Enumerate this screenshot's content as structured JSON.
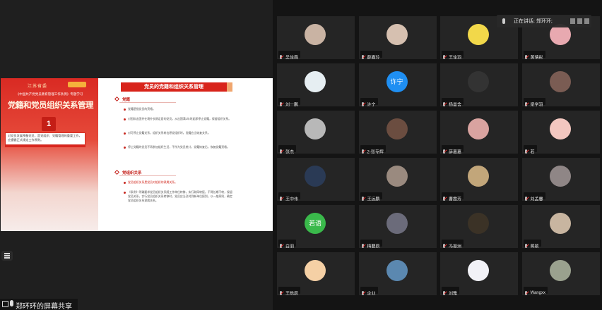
{
  "slide": {
    "logo": "江苏省委",
    "doc_title": "《中国共产党党员教育管理工作条例》专题学习",
    "main_title": "党籍和党员组织关系管理",
    "number": "1",
    "box_text": "对党员发展预备党员，是党组织、党籍管理的重要工作，应遵循正式规定工作原则。",
    "heading": "党员的党籍和组织关系管理",
    "section1": "党籍",
    "bullets1": [
      "党籍是指党员的资格。",
      "对因私出国并在境外长期定居的党员，从出国满2年时起即停止党籍，保留组织关系。",
      "对可停止党籍关系，组织关系转出原党组织时，党籍应当恢复关系。",
      "停止党籍的党员不再参加组织生活，不作为党员统计，党籍恢复后，恢复党籍资格。"
    ],
    "section2": "党组织关系",
    "bullets2": [
      "党员组织关系是党员对组织的隶属关系。",
      "《条例》明确要求党员组织关系随工作单位转移，实行联网转接，不得长期不转，保留党员关系，实行党员组织关系转移时，党员应当及时到新单位报到。以一般原则，确定党员组织关系隶属关系。"
    ]
  },
  "footer": {
    "text": "郑环环的屏幕共享"
  },
  "speaking": {
    "text": "正在讲话: 郑环环;"
  },
  "participants": [
    {
      "name": "吴佳霖",
      "avatar": "photo",
      "color": "#c9b3a3"
    },
    {
      "name": "薛嘉玲",
      "avatar": "photo",
      "color": "#d6c0b0"
    },
    {
      "name": "王佳羽",
      "avatar": "sponge",
      "color": "#f2d84a"
    },
    {
      "name": "黄晴彤",
      "avatar": "cartoon",
      "color": "#e8a9b0"
    },
    {
      "name": "刘一鹏",
      "avatar": "cartoon",
      "color": "#e6eef2"
    },
    {
      "name": "许宁",
      "avatar": "text",
      "text": "许宁",
      "color": "#1f8ff2"
    },
    {
      "name": "杨曼舍",
      "avatar": "dark",
      "color": "#333"
    },
    {
      "name": "梁学羽",
      "avatar": "photo",
      "color": "#7a5c53"
    },
    {
      "name": "张杰",
      "avatar": "photo",
      "color": "#b8b8b8"
    },
    {
      "name": "2-张专辉",
      "avatar": "photo",
      "color": "#6b4d40"
    },
    {
      "name": "薛嘉嘉",
      "avatar": "photo",
      "color": "#d9a3a0"
    },
    {
      "name": "若",
      "avatar": "cartoon",
      "color": "#f3c7c0"
    },
    {
      "name": "王中伟",
      "avatar": "dark",
      "color": "#2a3a55"
    },
    {
      "name": "王远鹏",
      "avatar": "photo",
      "color": "#9a8a7f"
    },
    {
      "name": "曹霞芳",
      "avatar": "photo",
      "color": "#c2a67a"
    },
    {
      "name": "刘孟馨",
      "avatar": "photo",
      "color": "#8f8686"
    },
    {
      "name": "白羽",
      "avatar": "text",
      "text": "若语",
      "color": "#3ab94b"
    },
    {
      "name": "梅要辰",
      "avatar": "photo",
      "color": "#6b6b7a"
    },
    {
      "name": "冯振洲",
      "avatar": "cartoon",
      "color": "#3b3226"
    },
    {
      "name": "蒋颖",
      "avatar": "photo",
      "color": "#c8b5a0"
    },
    {
      "name": "王皓辰",
      "avatar": "cartoon",
      "color": "#f5d0a5"
    },
    {
      "name": "企业",
      "avatar": "photo",
      "color": "#5b88b0"
    },
    {
      "name": "刘雅",
      "avatar": "cartoon",
      "color": "#f2f2f7"
    },
    {
      "name": "Wangxx",
      "avatar": "photo",
      "color": "#9aa18e"
    }
  ]
}
